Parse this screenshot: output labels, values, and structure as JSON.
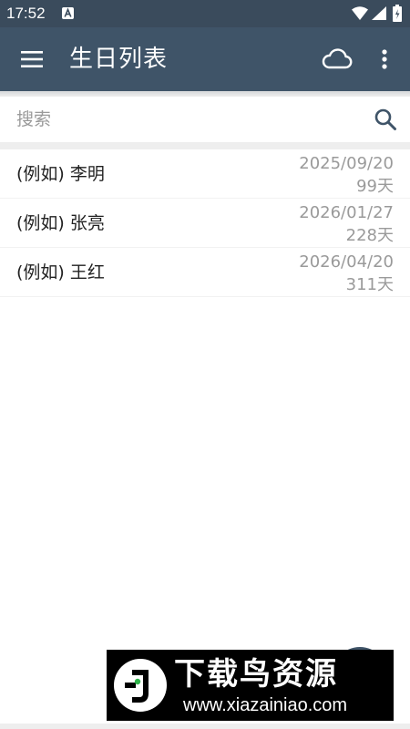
{
  "status_bar": {
    "time": "17:52",
    "notification_icon": "a-badge-icon",
    "icons": [
      "wifi-icon",
      "cell-signal-icon",
      "battery-icon"
    ]
  },
  "app_bar": {
    "title": "生日列表",
    "menu_icon": "hamburger-menu-icon",
    "sync_icon": "cloud-icon",
    "overflow_icon": "more-vert-icon",
    "color": "#3f5468"
  },
  "search": {
    "placeholder": "搜索",
    "value": "",
    "icon": "search-icon"
  },
  "birthdays": [
    {
      "name": "(例如) 李明",
      "date": "2025/09/20",
      "days_left": "99天"
    },
    {
      "name": "(例如) 张亮",
      "date": "2026/01/27",
      "days_left": "228天"
    },
    {
      "name": "(例如) 王红",
      "date": "2026/04/20",
      "days_left": "311天"
    }
  ],
  "watermark": {
    "title": "下载鸟资源",
    "url": "www.xiazainiao.com"
  }
}
